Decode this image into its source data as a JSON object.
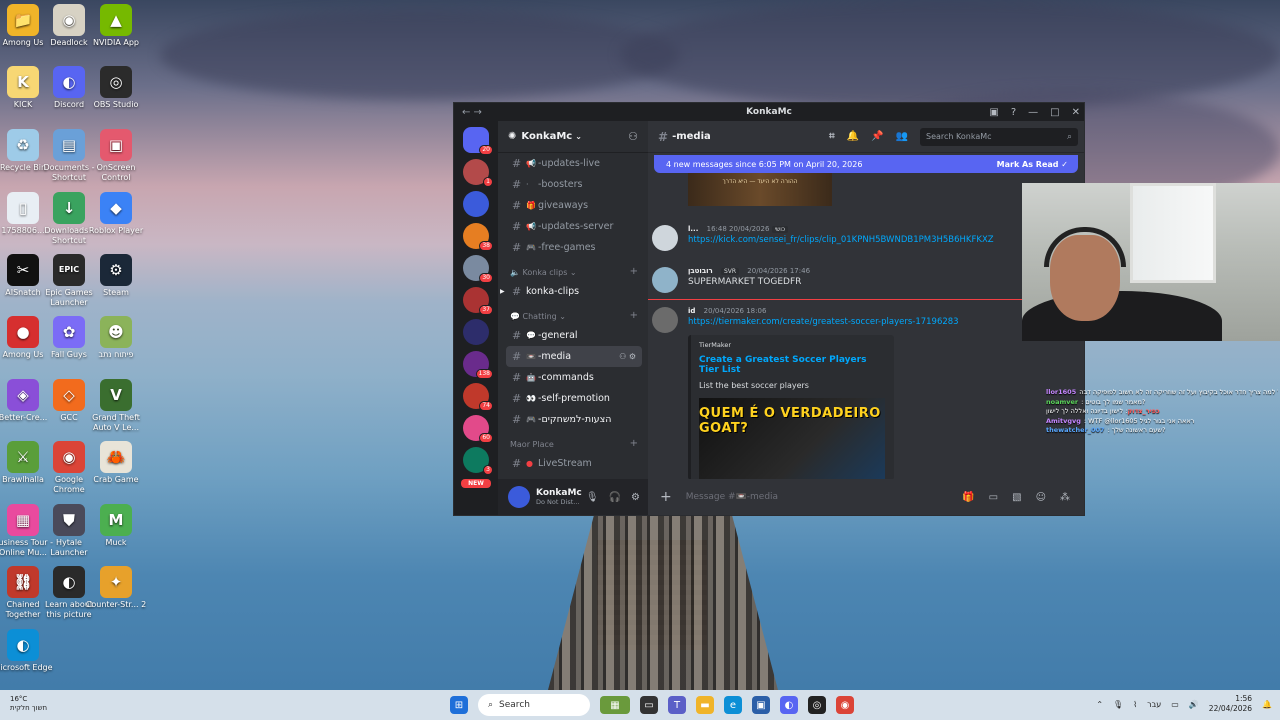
{
  "desktop": {
    "icons": [
      {
        "label": "Among Us",
        "color": "#f0b429",
        "glyph": "📁"
      },
      {
        "label": "Deadlock",
        "color": "#d7d2c4",
        "glyph": "◉"
      },
      {
        "label": "NVIDIA App",
        "color": "#76b900",
        "glyph": "▲"
      },
      {
        "label": "KICK",
        "color": "#f7d774",
        "glyph": "K"
      },
      {
        "label": "Discord",
        "color": "#5865f2",
        "glyph": "◐"
      },
      {
        "label": "OBS Studio",
        "color": "#2b2b2b",
        "glyph": "◎"
      },
      {
        "label": "Recycle Bin",
        "color": "#9ecbe8",
        "glyph": "♻"
      },
      {
        "label": "Documents - Shortcut",
        "color": "#6aa0d8",
        "glyph": "▤"
      },
      {
        "label": "OnScreen Control",
        "color": "#e4596e",
        "glyph": "▣"
      },
      {
        "label": "1758806...",
        "color": "#e8eef4",
        "glyph": "▯"
      },
      {
        "label": "Downloads - Shortcut",
        "color": "#3aa35f",
        "glyph": "↓"
      },
      {
        "label": "Roblox Player",
        "color": "#3b82f6",
        "glyph": "◆"
      },
      {
        "label": "AISnatch",
        "color": "#111111",
        "glyph": "✂"
      },
      {
        "label": "Epic Games Launcher",
        "color": "#2a2a2a",
        "glyph": "EPIC"
      },
      {
        "label": "Steam",
        "color": "#1b2838",
        "glyph": "⚙"
      },
      {
        "label": "Among Us",
        "color": "#d62f2f",
        "glyph": "●"
      },
      {
        "label": "Fall Guys",
        "color": "#7b6cf6",
        "glyph": "✿"
      },
      {
        "label": "פיתוח נתב",
        "color": "#8bb35a",
        "glyph": "☻"
      },
      {
        "label": "Better-Cre...",
        "color": "#8a4fd8",
        "glyph": "◈"
      },
      {
        "label": "GCC",
        "color": "#f26b1d",
        "glyph": "◇"
      },
      {
        "label": "Grand Theft Auto V Le...",
        "color": "#3a6e2f",
        "glyph": "V"
      },
      {
        "label": "Brawlhalla",
        "color": "#5a9e3a",
        "glyph": "⚔"
      },
      {
        "label": "Google Chrome",
        "color": "#db4437",
        "glyph": "◉"
      },
      {
        "label": "Crab Game",
        "color": "#e8e4d8",
        "glyph": "🦀"
      },
      {
        "label": "Business Tour - Online Mu...",
        "color": "#e94a9e",
        "glyph": "▦"
      },
      {
        "label": "Hytale Launcher",
        "color": "#4a4a5a",
        "glyph": "⛊"
      },
      {
        "label": "Muck",
        "color": "#4caf50",
        "glyph": "M"
      },
      {
        "label": "Chained Together",
        "color": "#c0392b",
        "glyph": "⛓"
      },
      {
        "label": "Learn about this picture",
        "color": "#2a2a2a",
        "glyph": "◐"
      },
      {
        "label": "Counter-Str... 2",
        "color": "#e7a12b",
        "glyph": "✦"
      },
      {
        "label": "Microsoft Edge",
        "color": "#0c8fd6",
        "glyph": "◐"
      }
    ]
  },
  "discord": {
    "window_title": "KonkaMc",
    "guild_name": "KonkaMc",
    "channel_header": "-media",
    "search_placeholder": "Search KonkaMc",
    "new_messages": "4 new messages since 6:05 PM on April 20, 2026",
    "mark_as_read": "Mark As Read",
    "servers": [
      {
        "color": "#5865f2",
        "badge": "20"
      },
      {
        "color": "#b34a4a",
        "badge": "1"
      },
      {
        "color": "#3b5bdb",
        "badge": ""
      },
      {
        "color": "#e67e22",
        "badge": "38"
      },
      {
        "color": "#7a8aa0",
        "badge": "30"
      },
      {
        "color": "#a33",
        "badge": "37"
      },
      {
        "color": "#2d2d6b",
        "badge": ""
      },
      {
        "color": "#6a2b8c",
        "badge": "138"
      },
      {
        "color": "#c0392b",
        "badge": "74"
      },
      {
        "color": "#e24a8a",
        "badge": "60"
      },
      {
        "color": "#0d7a5f",
        "badge": "3"
      }
    ],
    "new_label": "NEW",
    "channels_top": [
      {
        "name": "-updates-live",
        "emoji": "📢"
      },
      {
        "name": "-boosters",
        "emoji": "·"
      },
      {
        "name": "giveaways",
        "emoji": "🎁"
      },
      {
        "name": "-updates-server",
        "emoji": "📢"
      },
      {
        "name": "-free-games",
        "emoji": "🎮"
      }
    ],
    "cat_clips": "Konka clips",
    "channel_clips": "konka-clips",
    "cat_chatting": "Chatting",
    "channels_chatting": [
      {
        "name": "-general",
        "emoji": "💬"
      },
      {
        "name": "-media",
        "emoji": "📼"
      },
      {
        "name": "-commands",
        "emoji": "🤖"
      },
      {
        "name": "-self-premotion",
        "emoji": "👀"
      },
      {
        "name": "-הצעות-למשחקים",
        "emoji": "🎮"
      }
    ],
    "cat_maor": "Maor Place",
    "channel_livestream": "LiveStream",
    "user": {
      "name": "KonkaMc",
      "status": "Do Not Dist..."
    },
    "top_embed_text": "ההורה לא היעד — היא הדרך",
    "messages": [
      {
        "name": "l...",
        "tag": "כושי",
        "time": "20/04/2026 16:48",
        "content": "https://kick.com/sensei_fr/clips/clip_01KPNH5BWNDB1PM3H5B6HKFKXZ"
      },
      {
        "name": "רובוטבן",
        "tag": "SVR",
        "time": "20/04/2026 17:46",
        "content": "SUPERMARKET TOGEDFR"
      },
      {
        "name": "id",
        "tag": "",
        "time": "20/04/2026 18:06",
        "content": "https://tiermaker.com/create/greatest-soccer-players-17196283"
      }
    ],
    "embed": {
      "provider": "TierMaker",
      "title": "Create a Greatest Soccer Players Tier List",
      "desc": "List the best soccer players",
      "image_text": "QUEM É O VERDADEIRO GOAT?"
    },
    "composer_placeholder": "Message #📼-media"
  },
  "chat_overlay": [
    {
      "user": "llor1605",
      "color": "#c586ff",
      "text": "וזה לא דיבר איתך מאקינג 3 שעות על למה צריך חדר אוכל בקיבוץ ועל זה שוזריקה זה לא חשוב לפופיקה דבה"
    },
    {
      "user": "noamver",
      "color": "#5ad35a",
      "text": ": מאמר שמו לך בוטים?"
    },
    {
      "user": "כפיר_צדוק",
      "color": "#ff5a5a",
      "text": ": לישון בדיונה ואללה לך לישון"
    },
    {
      "user": "Amitvgvg",
      "color": "#c586ff",
      "text": ": WTF @llor1605 ראאה אני בגור לגיל"
    },
    {
      "user": "thewatcher_007",
      "color": "#5aa8ff",
      "text": ": שעם ראשונה שלך?"
    }
  ],
  "taskbar": {
    "weather_temp": "16°C",
    "weather_desc": "חשוך חלקית",
    "search": "Search",
    "lang": "עבר",
    "time": "1:56",
    "date": "22/04/2026"
  }
}
